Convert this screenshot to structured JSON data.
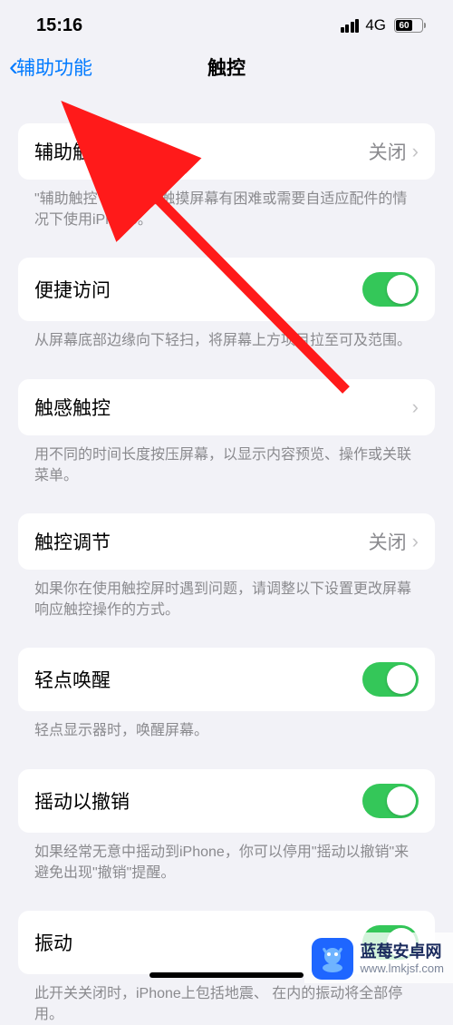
{
  "status": {
    "time": "15:16",
    "network": "4G",
    "battery_percent": "60"
  },
  "nav": {
    "back": "辅助功能",
    "title": "触控"
  },
  "rows": {
    "assistive_touch": {
      "label": "辅助触控",
      "value": "关闭",
      "footer": "\"辅助触控\"可让你在触摸屏幕有困难或需要自适应配件的情况下使用iPhone。"
    },
    "reachability": {
      "label": "便捷访问",
      "footer": "从屏幕底部边缘向下轻扫，将屏幕上方项目拉至可及范围。"
    },
    "haptic_touch": {
      "label": "触感触控",
      "footer": "用不同的时间长度按压屏幕，以显示内容预览、操作或关联菜单。"
    },
    "touch_accommodations": {
      "label": "触控调节",
      "value": "关闭",
      "footer": "如果你在使用触控屏时遇到问题，请调整以下设置更改屏幕响应触控操作的方式。"
    },
    "tap_to_wake": {
      "label": "轻点唤醒",
      "footer": "轻点显示器时，唤醒屏幕。"
    },
    "shake_to_undo": {
      "label": "摇动以撤销",
      "footer": "如果经常无意中摇动到iPhone，你可以停用\"摇动以撤销\"来避免出现\"撤销\"提醒。"
    },
    "vibration": {
      "label": "振动",
      "footer": "此开关关闭时，iPhone上包括地震、             在内的振动将全部停用。"
    }
  },
  "watermark": {
    "title": "蓝莓安卓网",
    "url": "www.lmkjsf.com"
  }
}
